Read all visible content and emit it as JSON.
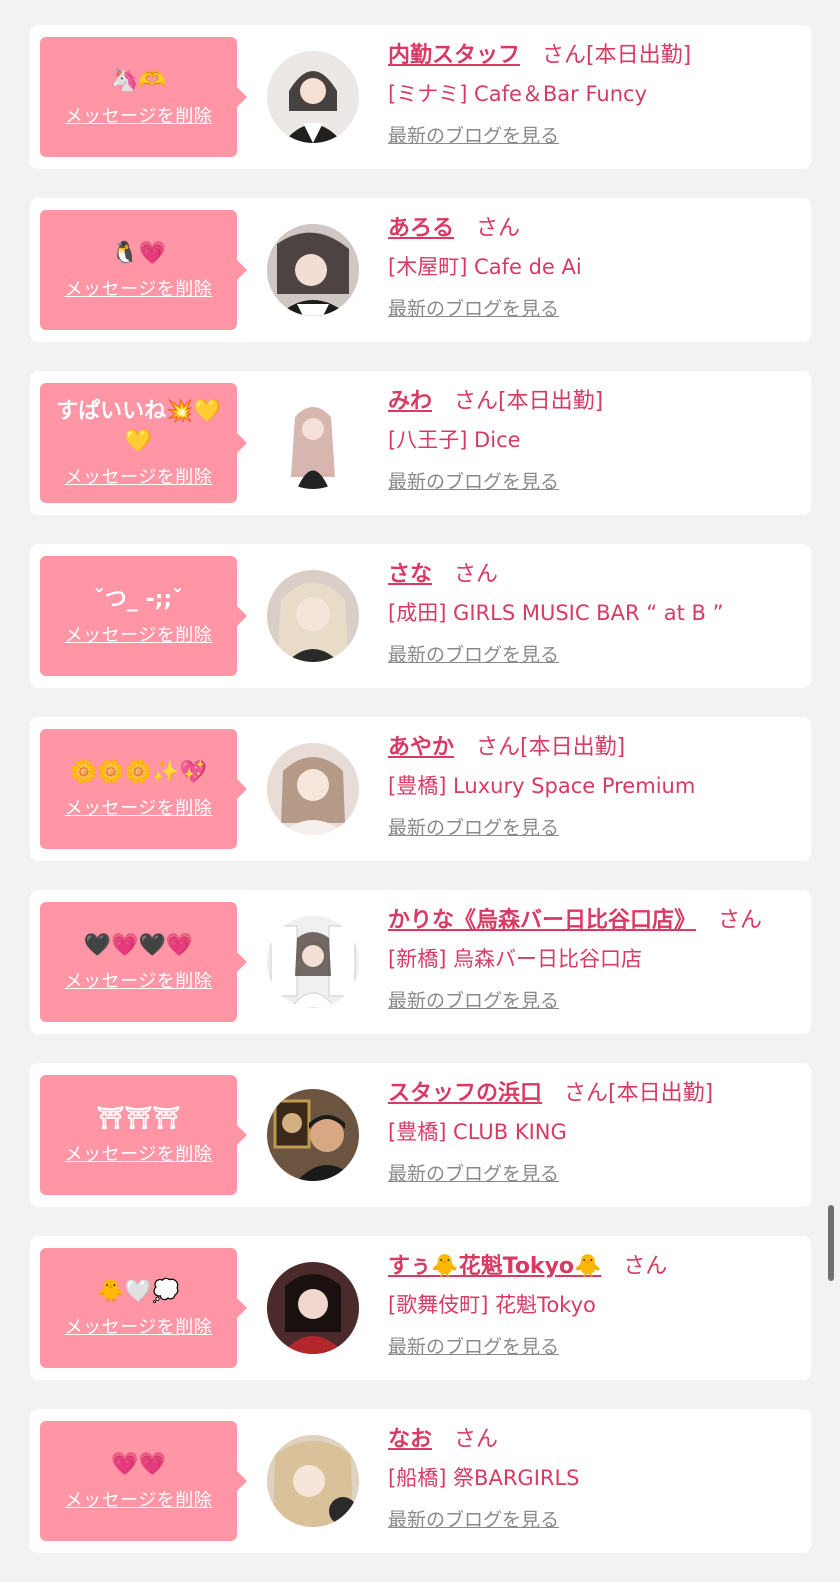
{
  "common": {
    "delete_label": "メッセージを削除",
    "blog_label": "最新のブログを見る",
    "san_label": "さん"
  },
  "cards": [
    {
      "message": "🦄🫶",
      "name": "内勤スタッフ",
      "status": "[本日出勤]",
      "shop": "[ミナミ] Cafe＆Bar Funcy",
      "avatar_color": "#ece8e6"
    },
    {
      "message": "🐧💗",
      "name": "あろる",
      "status": "",
      "shop": "[木屋町] Cafe de Ai",
      "avatar_color": "#cfc7c4"
    },
    {
      "message": "すぱいいね💥💛💛",
      "name": "みわ",
      "status": "[本日出勤]",
      "shop": "[八王子] Dice",
      "avatar_color": "#f4ecea"
    },
    {
      "message": "ˇつ_ -;;ˇ",
      "name": "さな",
      "status": "",
      "shop": "[成田] GIRLS MUSIC BAR “ at B ”",
      "avatar_color": "#d9cfc8"
    },
    {
      "message": "🌼🌼🌼✨💖",
      "name": "あやか",
      "status": "[本日出勤]",
      "shop": "[豊橋] Luxury Space Premium",
      "avatar_color": "#e8ddd6"
    },
    {
      "message": "🖤💗🖤💗",
      "name": "かりな《烏森バー日比谷口店》",
      "status": "",
      "shop": "[新橋] 烏森バー日比谷口店",
      "avatar_color": "#f0f0f0"
    },
    {
      "message": "⛩⛩⛩",
      "name": "スタッフの浜口",
      "status": "[本日出勤]",
      "shop": "[豊橋] CLUB KING",
      "avatar_color": "#6b5540"
    },
    {
      "message": "🐥🤍💭",
      "name": "すぅ🐥花魁Tokyo🐥",
      "status": "",
      "shop": "[歌舞伎町] 花魁Tokyo",
      "avatar_color": "#4a2a2a"
    },
    {
      "message": "💗💗",
      "name": "なお",
      "status": "",
      "shop": "[船橋] 祭BARGIRLS",
      "avatar_color": "#e0d2c0"
    }
  ],
  "colors": {
    "accent": "#d93a63",
    "bubble": "#ff95a5",
    "background": "#f2f2f2",
    "blog_link": "#8a8a8a"
  }
}
